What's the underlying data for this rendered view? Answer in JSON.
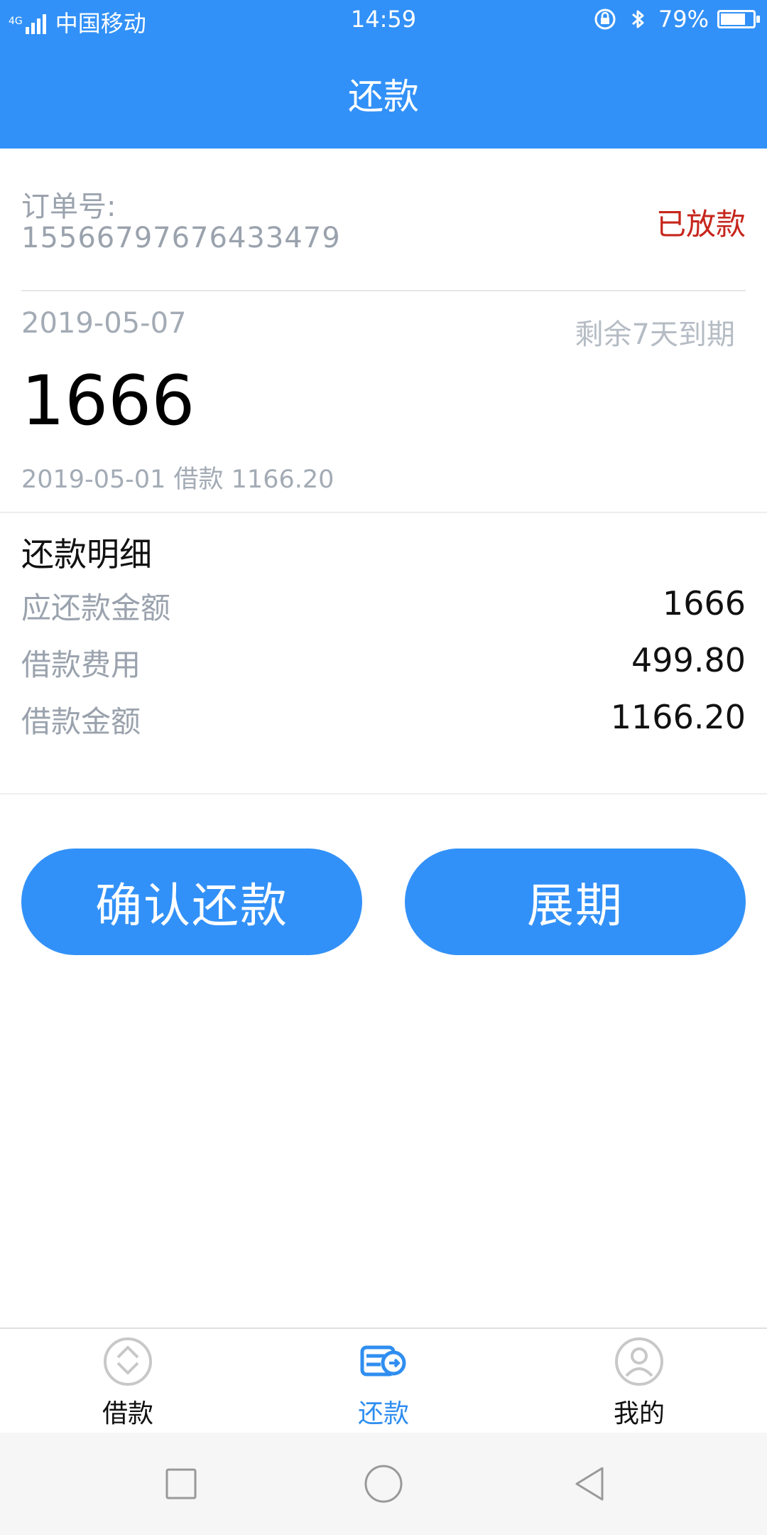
{
  "status_bar": {
    "network_tag": "4G",
    "carrier": "中国移动",
    "time": "14:59",
    "battery_percent": "79%",
    "battery_level": 0.79
  },
  "header": {
    "title": "还款"
  },
  "order": {
    "label": "订单号:",
    "number": "15566797676433479",
    "status": "已放款"
  },
  "summary": {
    "due_date": "2019-05-07",
    "remaining": "剩余7天到期",
    "amount": "1666",
    "loan_info": "2019-05-01 借款 1166.20"
  },
  "details": {
    "title": "还款明细",
    "rows": [
      {
        "label": "应还款金额",
        "value": "1666"
      },
      {
        "label": "借款费用",
        "value": "499.80"
      },
      {
        "label": "借款金额",
        "value": "1166.20"
      }
    ]
  },
  "actions": {
    "confirm_label": "确认还款",
    "extend_label": "展期"
  },
  "tabs": [
    {
      "label": "借款",
      "icon": "borrow-icon"
    },
    {
      "label": "还款",
      "icon": "repay-icon",
      "active": true
    },
    {
      "label": "我的",
      "icon": "profile-icon"
    }
  ],
  "colors": {
    "primary": "#3291f8",
    "status_red": "#c6261c",
    "muted_text": "#9aa2ad"
  }
}
